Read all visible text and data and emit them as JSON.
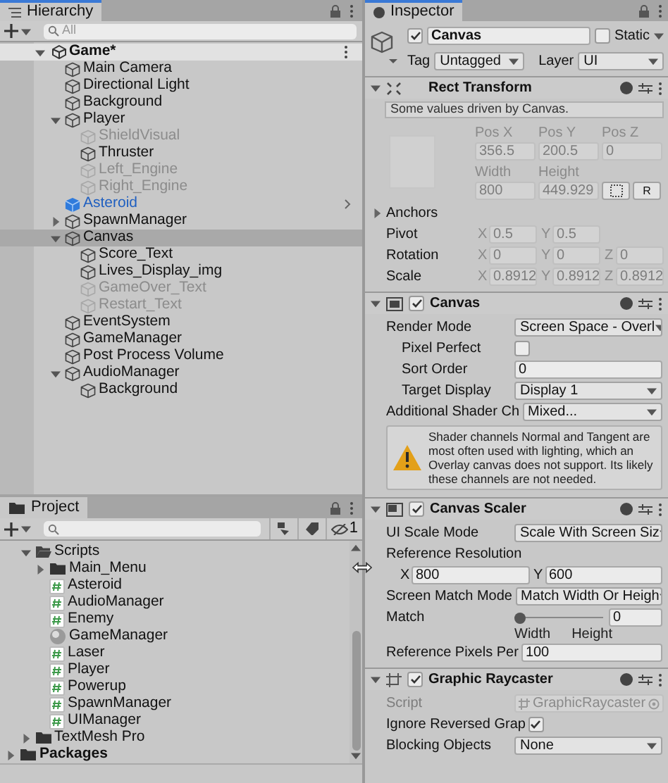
{
  "hierarchy": {
    "title": "Hierarchy",
    "search_placeholder": "All",
    "scene": {
      "name": "Game*",
      "expanded": true
    },
    "items": [
      {
        "name": "Main Camera",
        "kind": "gameobject",
        "active": true,
        "selected": false
      },
      {
        "name": "Directional Light",
        "kind": "gameobject",
        "active": true,
        "selected": false
      },
      {
        "name": "Background",
        "kind": "gameobject",
        "active": true,
        "selected": false
      },
      {
        "name": "Player",
        "kind": "gameobject",
        "active": true,
        "selected": false,
        "expanded": true,
        "children": [
          {
            "name": "ShieldVisual",
            "kind": "gameobject",
            "active": false,
            "selected": false
          },
          {
            "name": "Thruster",
            "kind": "gameobject",
            "active": true,
            "selected": false
          },
          {
            "name": "Left_Engine",
            "kind": "gameobject",
            "active": false,
            "selected": false
          },
          {
            "name": "Right_Engine",
            "kind": "gameobject",
            "active": false,
            "selected": false
          }
        ]
      },
      {
        "name": "Asteroid",
        "kind": "prefab",
        "active": true,
        "selected": false
      },
      {
        "name": "SpawnManager",
        "kind": "gameobject",
        "active": true,
        "selected": false,
        "expanded": false
      },
      {
        "name": "Canvas",
        "kind": "gameobject",
        "active": true,
        "selected": true,
        "expanded": true,
        "children": [
          {
            "name": "Score_Text",
            "kind": "gameobject",
            "active": true,
            "selected": false
          },
          {
            "name": "Lives_Display_img",
            "kind": "gameobject",
            "active": true,
            "selected": false
          },
          {
            "name": "GameOver_Text",
            "kind": "gameobject",
            "active": false,
            "selected": false
          },
          {
            "name": "Restart_Text",
            "kind": "gameobject",
            "active": false,
            "selected": false
          }
        ]
      },
      {
        "name": "EventSystem",
        "kind": "gameobject",
        "active": true,
        "selected": false
      },
      {
        "name": "GameManager",
        "kind": "gameobject",
        "active": true,
        "selected": false
      },
      {
        "name": "Post Process Volume",
        "kind": "gameobject",
        "active": true,
        "selected": false
      },
      {
        "name": "AudioManager",
        "kind": "gameobject",
        "active": true,
        "selected": false,
        "expanded": true,
        "children": [
          {
            "name": "Background",
            "kind": "gameobject",
            "active": true,
            "selected": false
          }
        ]
      }
    ]
  },
  "project": {
    "title": "Project",
    "hidden_count": "1",
    "tree": [
      {
        "children": [
          {
            "name": "Scripts",
            "kind": "folder",
            "expanded": true,
            "children": [
              {
                "name": "Main_Menu",
                "kind": "folder",
                "expanded": false
              },
              {
                "name": "Asteroid",
                "kind": "script"
              },
              {
                "name": "AudioManager",
                "kind": "script"
              },
              {
                "name": "Enemy",
                "kind": "script"
              },
              {
                "name": "GameManager",
                "kind": "asset"
              },
              {
                "name": "Laser",
                "kind": "script"
              },
              {
                "name": "Player",
                "kind": "script"
              },
              {
                "name": "Powerup",
                "kind": "script"
              },
              {
                "name": "SpawnManager",
                "kind": "script"
              },
              {
                "name": "UIManager",
                "kind": "script"
              }
            ]
          },
          {
            "name": "TextMesh Pro",
            "kind": "folder",
            "expanded": false
          }
        ]
      },
      {
        "name": "Packages",
        "kind": "root",
        "expanded": false
      }
    ]
  },
  "inspector": {
    "title": "Inspector",
    "object": {
      "name": "Canvas",
      "active": true,
      "static": false,
      "static_label": "Static",
      "tag_label": "Tag",
      "tag": "Untagged",
      "layer_label": "Layer",
      "layer": "UI"
    },
    "components": [
      {
        "kind": "rect_transform",
        "title": "Rect Transform",
        "expanded": true,
        "rows": [
          {
            "kind": "note",
            "text": "Some values driven by Canvas."
          },
          {
            "kind": "transform_grid",
            "disabled": true,
            "button_label": "R",
            "rows": [
              [
                {
                  "label": "Pos X",
                  "value": "356.5"
                },
                {
                  "label": "Pos Y",
                  "value": "200.5"
                },
                {
                  "label": "Pos Z",
                  "value": "0"
                }
              ],
              [
                {
                  "label": "Width",
                  "value": "800"
                },
                {
                  "label": "Height",
                  "value": "449.929"
                }
              ]
            ]
          },
          {
            "kind": "foldout",
            "label": "Anchors",
            "expanded": false
          },
          {
            "kind": "vector",
            "label": "Pivot",
            "disabled": true,
            "fields": [
              {
                "axis": "X",
                "value": "0.5"
              },
              {
                "axis": "Y",
                "value": "0.5"
              }
            ]
          },
          {
            "kind": "vector",
            "label": "Rotation",
            "disabled": true,
            "fields": [
              {
                "axis": "X",
                "value": "0"
              },
              {
                "axis": "Y",
                "value": "0"
              },
              {
                "axis": "Z",
                "value": "0"
              }
            ]
          },
          {
            "kind": "vector",
            "label": "Scale",
            "disabled": true,
            "fields": [
              {
                "axis": "X",
                "value": "0.8912"
              },
              {
                "axis": "Y",
                "value": "0.8912"
              },
              {
                "axis": "Z",
                "value": "0.8912"
              }
            ]
          }
        ]
      },
      {
        "kind": "canvas",
        "title": "Canvas",
        "enabled": true,
        "expanded": true,
        "rows": [
          {
            "kind": "dropdown",
            "label": "Render Mode",
            "value": "Screen Space - Overl",
            "children": [
              {
                "kind": "checkbox",
                "label": "Pixel Perfect",
                "checked": false
              },
              {
                "kind": "text_field",
                "label": "Sort Order",
                "value": "0"
              },
              {
                "kind": "dropdown",
                "label": "Target Display",
                "value": "Display 1"
              }
            ]
          },
          {
            "kind": "dropdown",
            "label": "Additional Shader Ch",
            "value": "Mixed..."
          },
          {
            "kind": "warning",
            "text": "Shader channels Normal and Tangent are most often used with lighting, which an Overlay canvas does not support. Its likely these channels are not needed."
          }
        ]
      },
      {
        "kind": "canvas_scaler",
        "title": "Canvas Scaler",
        "enabled": true,
        "expanded": true,
        "rows": [
          {
            "kind": "dropdown",
            "label": "UI Scale Mode",
            "value": "Scale With Screen Siz"
          },
          {
            "kind": "header",
            "label": "Reference Resolution",
            "children": [
              {
                "kind": "vector",
                "disabled": false,
                "fields": [
                  {
                    "axis": "X",
                    "value": "800"
                  },
                  {
                    "axis": "Y",
                    "value": "600"
                  }
                ]
              }
            ]
          },
          {
            "kind": "dropdown",
            "label": "Screen Match Mode",
            "value": "Match Width Or Heigh"
          },
          {
            "kind": "slider",
            "label": "Match",
            "level": 0,
            "value": "0",
            "min_label": "Width",
            "max_label": "Height"
          },
          {
            "kind": "text_field",
            "label": "Reference Pixels Per",
            "value": "100"
          }
        ]
      },
      {
        "kind": "graphic_raycaster",
        "title": "Graphic Raycaster",
        "enabled": true,
        "expanded": true,
        "rows": [
          {
            "kind": "object_field",
            "label": "Script",
            "value": "GraphicRaycaster",
            "disabled": true
          },
          {
            "kind": "checkbox",
            "label": "Ignore Reversed Grap",
            "checked": true
          },
          {
            "kind": "dropdown",
            "label": "Blocking Objects",
            "value": "None"
          }
        ]
      }
    ]
  }
}
